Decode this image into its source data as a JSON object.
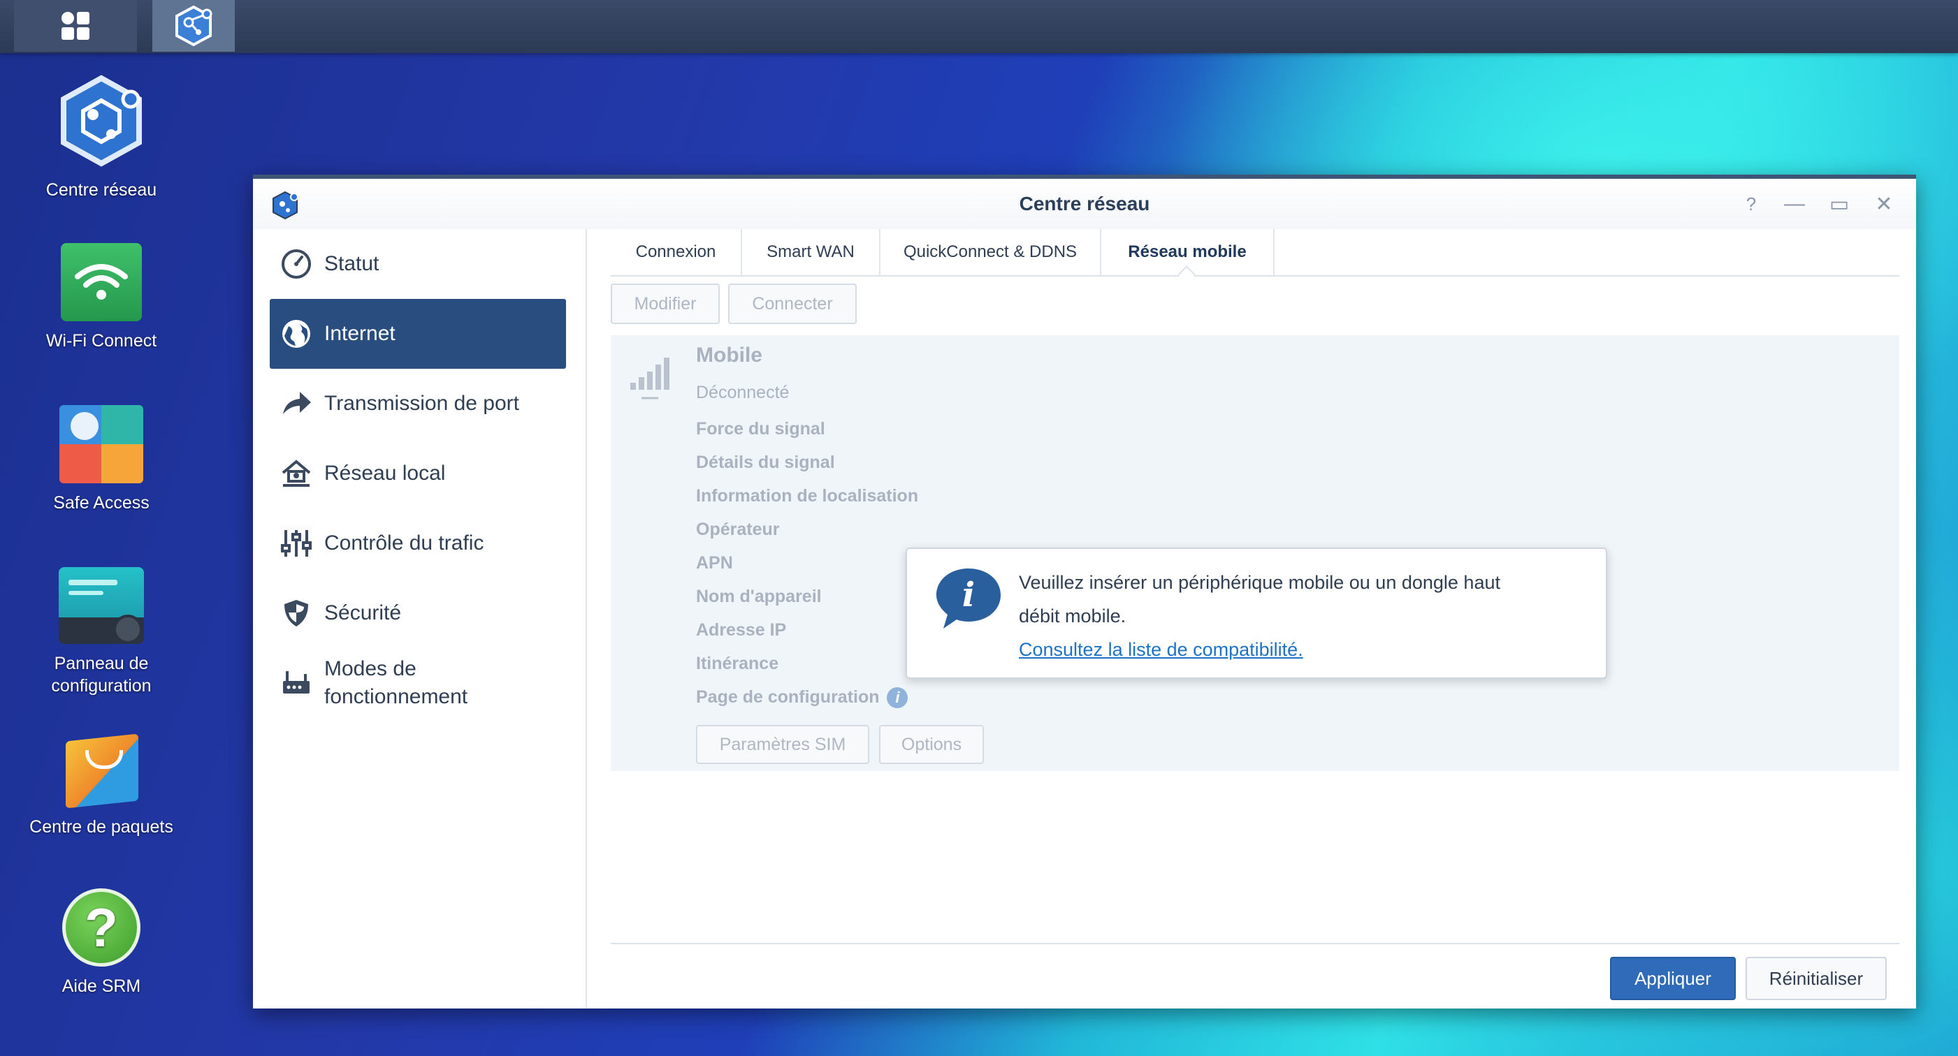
{
  "desktop": {
    "icons": [
      {
        "label": "Centre réseau"
      },
      {
        "label": "Wi-Fi Connect"
      },
      {
        "label": "Safe Access"
      },
      {
        "label": "Panneau de configuration"
      },
      {
        "label": "Centre de paquets"
      },
      {
        "label": "Aide SRM"
      }
    ]
  },
  "window": {
    "title": "Centre réseau",
    "controls": {
      "help": "?",
      "minimize": "—",
      "maximize": "▭",
      "close": "✕"
    }
  },
  "sidebar": {
    "items": [
      {
        "label": "Statut",
        "icon": "gauge-icon"
      },
      {
        "label": "Internet",
        "icon": "globe-icon",
        "active": true
      },
      {
        "label": "Transmission de port",
        "icon": "forward-arrow-icon"
      },
      {
        "label": "Réseau local",
        "icon": "home-network-icon"
      },
      {
        "label": "Contrôle du trafic",
        "icon": "sliders-icon"
      },
      {
        "label": "Sécurité",
        "icon": "shield-icon"
      },
      {
        "label": "Modes de fonctionnement",
        "icon": "router-modes-icon"
      }
    ]
  },
  "tabs": [
    {
      "label": "Connexion"
    },
    {
      "label": "Smart WAN"
    },
    {
      "label": "QuickConnect & DDNS"
    },
    {
      "label": "Réseau mobile",
      "active": true
    }
  ],
  "toolbar": {
    "modify_label": "Modifier",
    "connect_label": "Connecter"
  },
  "mobile": {
    "title": "Mobile",
    "status": "Déconnecté",
    "fields": [
      "Force du signal",
      "Détails du signal",
      "Information de localisation",
      "Opérateur",
      "APN",
      "Nom d'appareil",
      "Adresse IP",
      "Itinérance",
      "Page de configuration"
    ],
    "sim_button": "Paramètres SIM",
    "options_button": "Options"
  },
  "popup": {
    "line1": "Veuillez insérer un périphérique mobile ou un dongle haut",
    "line2": "débit mobile.",
    "link": "Consultez la liste de compatibilité."
  },
  "footer": {
    "apply_label": "Appliquer",
    "reset_label": "Réinitialiser"
  },
  "colors": {
    "accent": "#2f6bb8",
    "sidebar_active": "#284d7e",
    "link": "#1f73c6"
  }
}
